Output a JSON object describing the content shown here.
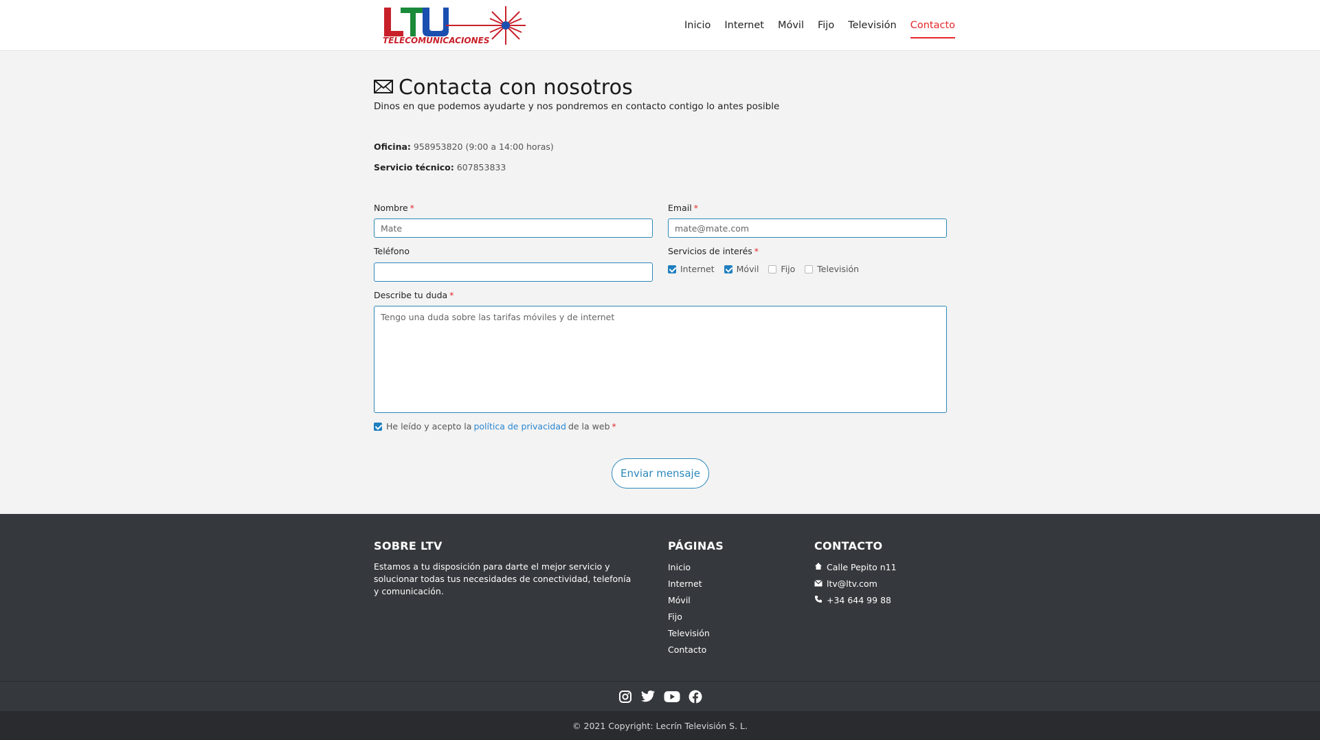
{
  "header": {
    "logo_text": "LTV",
    "logo_subtext": "TELECOMUNICACIONES",
    "nav": [
      {
        "label": "Inicio"
      },
      {
        "label": "Internet"
      },
      {
        "label": "Móvil"
      },
      {
        "label": "Fijo"
      },
      {
        "label": "Televisión"
      },
      {
        "label": "Contacto",
        "active": true
      }
    ]
  },
  "contact": {
    "title": "Contacta con nosotros",
    "subtitle": "Dinos en que podemos ayudarte y nos pondremos en contacto contigo lo antes posible",
    "office_label": "Oficina:",
    "office_value": "958953820 (9:00 a 14:00 horas)",
    "tech_label": "Servicio técnico:",
    "tech_value": "607853833"
  },
  "form": {
    "nombre_label": "Nombre",
    "nombre_value": "Mate",
    "email_label": "Email",
    "email_value": "mate@mate.com",
    "telefono_label": "Teléfono",
    "telefono_value": "",
    "servicios_label": "Servicios de interés",
    "servicios": [
      {
        "label": "Internet",
        "checked": true
      },
      {
        "label": "Móvil",
        "checked": true
      },
      {
        "label": "Fijo",
        "checked": false
      },
      {
        "label": "Televisión",
        "checked": false
      }
    ],
    "duda_label": "Describe tu duda",
    "duda_value": "Tengo una duda sobre las tarifas móviles y de internet",
    "required_mark": "*",
    "privacy_pre": "He leído y acepto la",
    "privacy_link": "política de privacidad",
    "privacy_post": "de la web",
    "privacy_checked": true,
    "submit_label": "Enviar mensaje"
  },
  "footer": {
    "about_title": "SOBRE LTV",
    "about_text": "Estamos a tu disposición para darte el mejor servicio y solucionar todas tus necesidades de conectividad, telefonía y comunicación.",
    "pages_title": "PÁGINAS",
    "pages": [
      "Inicio",
      "Internet",
      "Móvil",
      "Fijo",
      "Televisión",
      "Contacto"
    ],
    "contact_title": "CONTACTO",
    "address": "Calle Pepito n11",
    "email": "ltv@ltv.com",
    "phone": "+34 644 99 88",
    "social": [
      "instagram-icon",
      "twitter-icon",
      "youtube-icon",
      "facebook-icon"
    ],
    "copyright": "© 2021 Copyright: Lecrín Televisión S. L."
  },
  "colors": {
    "accent_red": "#e5262a",
    "accent_blue": "#2a86b8",
    "footer_bg": "#35383c",
    "page_bg": "#f3f3f3"
  }
}
